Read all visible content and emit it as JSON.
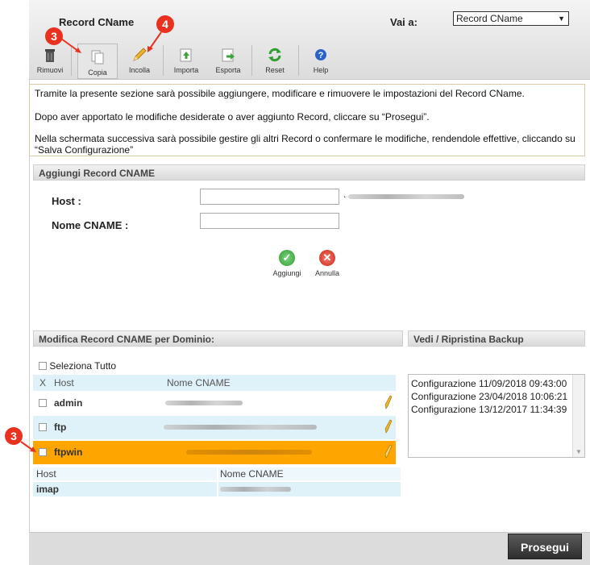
{
  "header": {
    "title": "Record CName",
    "goto_label": "Vai a:",
    "goto_value": "Record CName"
  },
  "toolbar": {
    "remove": "Rimuovi",
    "copy": "Copia",
    "paste": "Incolla",
    "import": "Importa",
    "export": "Esporta",
    "reset": "Reset",
    "help": "Help"
  },
  "badges": {
    "copy_badge": "3",
    "paste_badge": "4",
    "row_badge": "3"
  },
  "info": {
    "p1": "Tramite la presente sezione sarà possibile aggiungere, modificare e rimuovere le impostazioni del Record CName.",
    "p2": "Dopo aver apportato le modifiche desiderate o aver aggiunto Record, cliccare su “Prosegui”.",
    "p3": "Nella schermata successiva sarà possibile gestire gli altri Record o confermare le modifiche, rendendole effettive, cliccando su “Salva Configurazione”"
  },
  "add_panel": {
    "title": "Aggiungi Record CNAME",
    "host_label": "Host :",
    "cname_label": "Nome CNAME :",
    "add_button": "Aggiungi",
    "cancel_button": "Annulla"
  },
  "edit_panel": {
    "title": "Modifica Record CNAME per Dominio:",
    "select_all": "Seleziona Tutto",
    "col_x": "X",
    "col_host": "Host",
    "col_cname": "Nome CNAME",
    "rows": [
      {
        "host": "admin",
        "highlighted": false
      },
      {
        "host": "ftp",
        "highlighted": false
      },
      {
        "host": "ftpwin",
        "highlighted": true
      }
    ],
    "sub_table": {
      "col_host": "Host",
      "col_cname": "Nome CNAME",
      "host": "imap"
    }
  },
  "backup_panel": {
    "title": "Vedi / Ripristina Backup",
    "items": [
      "Configurazione 11/09/2018 09:43:00",
      "Configurazione 23/04/2018 10:06:21",
      "Configurazione 13/12/2017 11:34:39"
    ]
  },
  "footer": {
    "proceed": "Prosegui"
  },
  "colors": {
    "highlight_row": "#ffa500",
    "alt_row": "#dff1f9",
    "badge": "#e8321f"
  }
}
